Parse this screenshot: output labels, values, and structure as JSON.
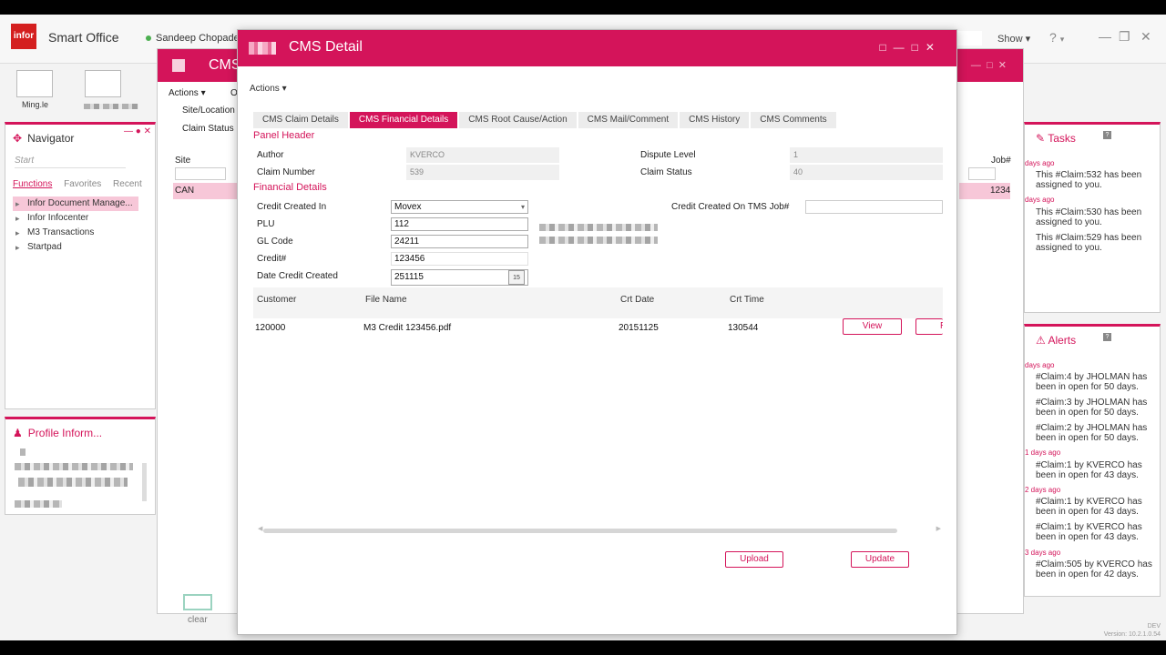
{
  "app": {
    "logo": "infor",
    "title": "Smart Office",
    "user": "Sandeep Chopade",
    "show_label": "Show",
    "help": "?"
  },
  "shortcuts": [
    {
      "label": "Ming.le"
    },
    {
      "label": ""
    }
  ],
  "navigator": {
    "title": "Navigator",
    "search_placeholder": "Start",
    "tabs": [
      "Functions",
      "Favorites",
      "Recent"
    ],
    "items": [
      "Infor Document Manage...",
      "Infor Infocenter",
      "M3 Transactions",
      "Startpad"
    ]
  },
  "profile": {
    "title": "Profile Inform..."
  },
  "background_window": {
    "title": "CMS",
    "actions": "Actions",
    "col_o": "O",
    "site_location": "Site/Location",
    "claim_status": "Claim Status",
    "site_col": "Site",
    "site_value": "CAN",
    "job_col": "Job#",
    "job_value": "1234",
    "clear_label": "clear"
  },
  "tasks": {
    "title": "Tasks",
    "entries": [
      {
        "ago": "days ago",
        "text": "This #Claim:532 has been assigned to you."
      },
      {
        "ago": "days ago",
        "text": "This #Claim:530 has been assigned to you."
      },
      {
        "ago": "",
        "text": "This #Claim:529 has been assigned to you."
      }
    ]
  },
  "alerts": {
    "title": "Alerts",
    "entries": [
      {
        "ago": "days ago",
        "text": "#Claim:4 by JHOLMAN has been in open for 50 days."
      },
      {
        "ago": "",
        "text": "#Claim:3 by JHOLMAN has been in open for 50 days."
      },
      {
        "ago": "",
        "text": "#Claim:2 by JHOLMAN has been in open for 50 days."
      },
      {
        "ago": "1 days ago",
        "text": "#Claim:1 by KVERCO has been in open for 43 days."
      },
      {
        "ago": "2 days ago",
        "text": "#Claim:1 by KVERCO has been in open for 43 days."
      },
      {
        "ago": "",
        "text": "#Claim:1 by KVERCO has been in open for 43 days."
      },
      {
        "ago": "3 days ago",
        "text": "#Claim:505 by KVERCO has been in open for 42 days."
      }
    ]
  },
  "modal": {
    "title": "CMS Detail",
    "actions": "Actions",
    "tabs": [
      "CMS Claim Details",
      "CMS Financial Details",
      "CMS Root Cause/Action",
      "CMS Mail/Comment",
      "CMS History",
      "CMS Comments"
    ],
    "active_tab": "CMS Financial Details",
    "panel_header": "Panel Header",
    "author_label": "Author",
    "author_value": "KVERCO",
    "claim_number_label": "Claim Number",
    "claim_number_value": "539",
    "dispute_level_label": "Dispute Level",
    "dispute_level_value": "1",
    "claim_status_label": "Claim Status",
    "claim_status_value": "40",
    "financial_details": "Financial Details",
    "credit_created_in_label": "Credit Created In",
    "credit_created_in_value": "Movex",
    "credit_on_tms_label": "Credit Created On TMS Job#",
    "credit_on_tms_value": "",
    "plu_label": "PLU",
    "plu_value": "112",
    "gl_code_label": "GL Code",
    "gl_code_value": "24211",
    "credit_no_label": "Credit#",
    "credit_no_value": "123456",
    "date_credit_label": "Date Credit Created",
    "date_credit_value": "251115",
    "calendar_day": "15",
    "grid": {
      "headers": [
        "Customer",
        "File Name",
        "Crt Date",
        "Crt Time"
      ],
      "rows": [
        {
          "customer": "120000",
          "file": "M3 Credit 123456.pdf",
          "date": "20151125",
          "time": "130544"
        }
      ]
    },
    "view_button": "View",
    "remove_button": "Rer",
    "upload_button": "Upload",
    "update_button": "Update"
  },
  "footer": {
    "env": "DEV",
    "version": "Version: 10.2.1.0.54"
  },
  "colors": {
    "accent": "#d4145a",
    "brand_red": "#d41f1f"
  }
}
